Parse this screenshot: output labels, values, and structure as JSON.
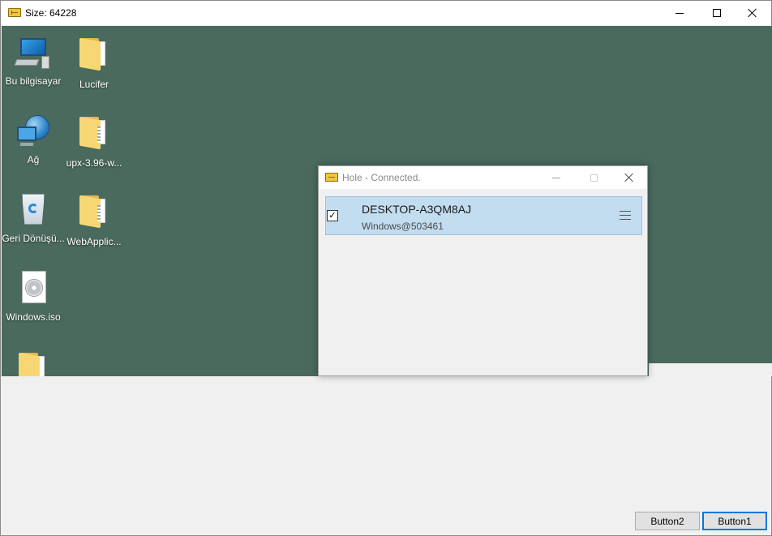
{
  "window": {
    "title": "Size: 64228"
  },
  "desktop": {
    "icons": [
      {
        "label": "Bu bilgisayar",
        "icon": "computer-icon"
      },
      {
        "label": "Lucifer",
        "icon": "folder-icon"
      },
      {
        "label": "Ağ",
        "icon": "network-icon"
      },
      {
        "label": "upx-3.96-w...",
        "icon": "folder-zip-icon"
      },
      {
        "label": "Geri Dönüşü...",
        "icon": "recycle-bin-icon"
      },
      {
        "label": "WebApplic...",
        "icon": "folder-zip-icon"
      },
      {
        "label": "Windows.iso",
        "icon": "iso-file-icon"
      }
    ],
    "background_color": "#4a6a5e"
  },
  "hole_window": {
    "title": "Hole - Connected.",
    "device": {
      "name": "DESKTOP-A3QM8AJ",
      "subtitle": "Windows@503461",
      "checked": true
    }
  },
  "buttons": {
    "button2": "Button2",
    "button1": "Button1"
  },
  "colors": {
    "selection": "#c2dcf0",
    "accent": "#0078d7"
  }
}
